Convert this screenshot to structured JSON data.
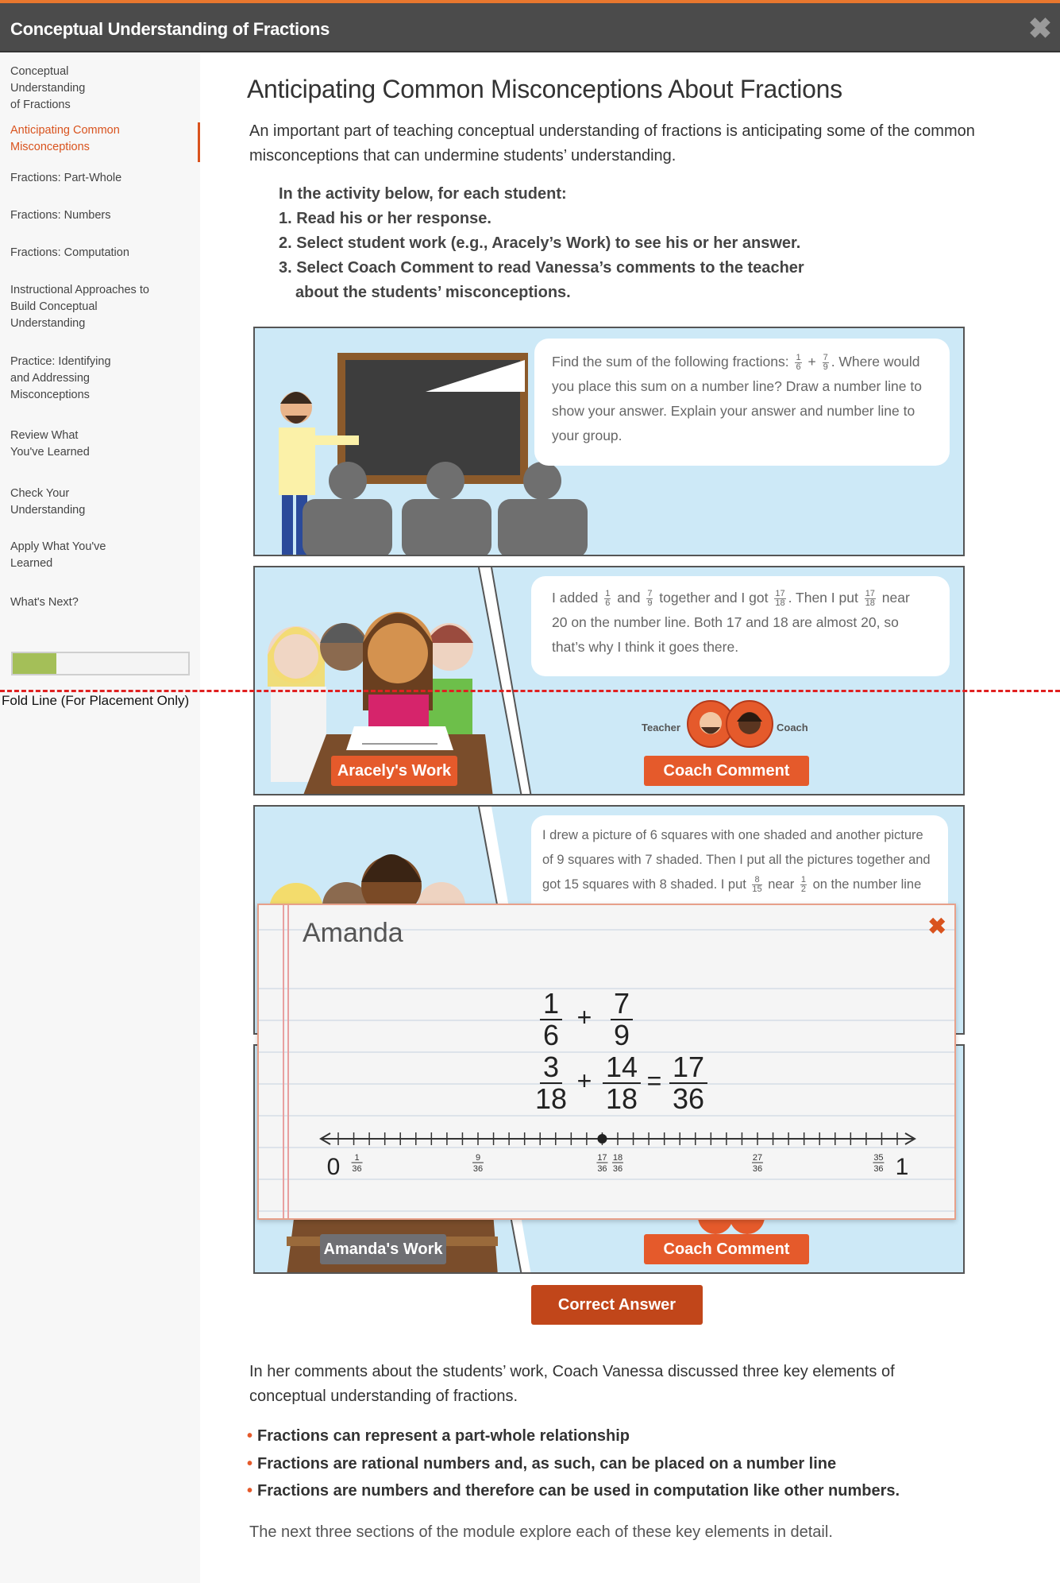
{
  "header": {
    "title": "Conceptual Understanding of Fractions",
    "close_icon": "close-x-icon"
  },
  "sidebar": {
    "items": [
      {
        "label": "Conceptual Understanding of Fractions",
        "active": false
      },
      {
        "label": "Anticipating Common Misconceptions",
        "active": true
      },
      {
        "label": "Fractions: Part-Whole",
        "active": false
      },
      {
        "label": "Fractions: Numbers",
        "active": false
      },
      {
        "label": "Fractions: Computation",
        "active": false
      },
      {
        "label": "Instructional Approaches to Build Conceptual Understanding",
        "active": false
      },
      {
        "label": "Practice: Identifying and Addressing Misconceptions",
        "active": false
      },
      {
        "label": "Review What You've Learned",
        "active": false
      },
      {
        "label": "Check Your Understanding",
        "active": false
      },
      {
        "label": "Apply What You've Learned",
        "active": false
      },
      {
        "label": "What's Next?",
        "active": false
      }
    ],
    "progress_percent": 25
  },
  "fold_label": "Fold Line (For Placement Only)",
  "main": {
    "title": "Anticipating Common Misconceptions About Fractions",
    "intro": "An important part of teaching conceptual understanding of fractions is anticipating some of the common misconceptions that can undermine students’ understanding.",
    "instructions": {
      "lead": "In the activity below, for each student:",
      "steps": [
        "1. Read his or her response.",
        "2. Select student work (e.g., Aracely’s Work) to see his or her answer.",
        "3. Select Coach Comment to read Vanessa’s comments to the teacher",
        "about the students’ misconceptions."
      ]
    },
    "prompt_bubble": [
      "Find the sum of the following fractions: ",
      {
        "n": "1",
        "d": "6"
      },
      " + ",
      {
        "n": "7",
        "d": "9"
      },
      ". Where would you place this sum on a number line? Draw a number line to show your answer. Explain your answer and number line to your group."
    ],
    "students": [
      {
        "bubble": [
          "I added ",
          {
            "n": "1",
            "d": "6"
          },
          " and ",
          {
            "n": "7",
            "d": "9"
          },
          " together and I got ",
          {
            "n": "17",
            "d": "18"
          },
          ". Then I put ",
          {
            "n": "17",
            "d": "18"
          },
          " near 20 on the number line. Both 17 and 18 are almost 20, so that’s why I think it goes there."
        ],
        "work_label": "Aracely's Work",
        "teacher_label": "Teacher",
        "coach_label": "Coach",
        "coach_button": "Coach Comment"
      },
      {
        "bubble": [
          "I drew a picture of 6 squares with one shaded and another picture of 9 squares with 7 shaded.  Then I put all the pictures together and got 15 squares with 8 shaded.  I put ",
          {
            "n": "8",
            "d": "15"
          },
          " near ",
          {
            "n": "1",
            "d": "2"
          },
          " on the number line"
        ]
      },
      {
        "work_label": "Amanda's Work",
        "coach_button": "Coach Comment"
      }
    ],
    "modal": {
      "name": "Amanda",
      "row1": [
        {
          "n": "1",
          "d": "6"
        },
        "+",
        {
          "n": "7",
          "d": "9"
        }
      ],
      "row2": [
        {
          "n": "3",
          "d": "18"
        },
        "+",
        {
          "n": "14",
          "d": "18"
        },
        "=",
        {
          "n": "17",
          "d": "36"
        }
      ],
      "number_line": {
        "min": 0,
        "max": 36,
        "ticks": 37,
        "point": 17,
        "labels": [
          {
            "at": 0,
            "text": "0",
            "big": true
          },
          {
            "at": 1,
            "n": "1",
            "d": "36"
          },
          {
            "at": 9,
            "n": "9",
            "d": "36"
          },
          {
            "at": 17,
            "n": "17",
            "d": "36"
          },
          {
            "at": 18,
            "n": "18",
            "d": "36"
          },
          {
            "at": 27,
            "n": "27",
            "d": "36"
          },
          {
            "at": 35,
            "n": "35",
            "d": "36"
          },
          {
            "at": 36,
            "text": "1",
            "big": true
          }
        ]
      }
    },
    "correct_button": "Correct Answer",
    "summary": "In her comments about the students’ work, Coach Vanessa discussed three key elements of conceptual understanding of fractions.",
    "bullets": [
      "Fractions can represent a part-whole relationship",
      "Fractions are rational numbers and, as such, can be placed on a number line",
      "Fractions are numbers and therefore can be used in computation like other numbers."
    ],
    "closing": "The next three sections of the module explore each of these key elements in detail."
  },
  "colors": {
    "accent": "#d9531e",
    "header_bg": "#4b4b4b",
    "top_stripe": "#e8772e",
    "panel_bg": "#cde9f7",
    "coach_button": "#e55a2b",
    "correct_button": "#c1461a",
    "progress_fill": "#a4bf58"
  }
}
